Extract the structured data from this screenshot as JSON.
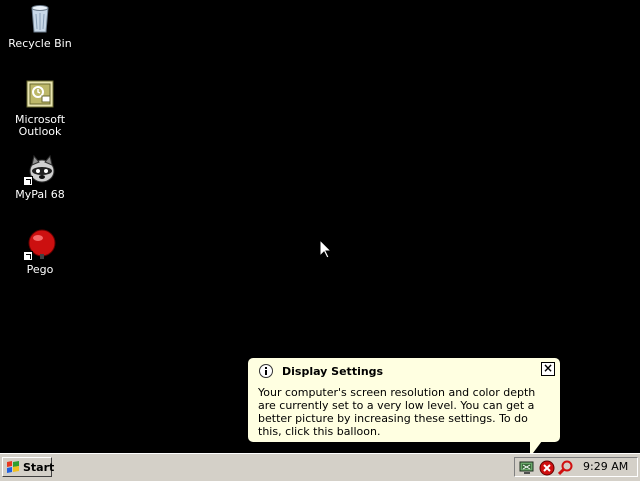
{
  "desktop": {
    "icons": [
      {
        "label": "Recycle Bin"
      },
      {
        "label": "Microsoft\nOutlook"
      },
      {
        "label": "MyPal 68"
      },
      {
        "label": "Pego"
      }
    ]
  },
  "balloon": {
    "title": "Display Settings",
    "close_label": "×",
    "body": "Your computer's screen resolution and color depth are currently set to a very low level. You can get a better picture by increasing these settings. To do this, click this balloon."
  },
  "taskbar": {
    "start_label": "Start",
    "clock": "9:29 AM"
  },
  "colors": {
    "desktop_bg": "#000000",
    "balloon_bg": "#ffffe1",
    "taskbar_bg": "#d4d0c8"
  }
}
